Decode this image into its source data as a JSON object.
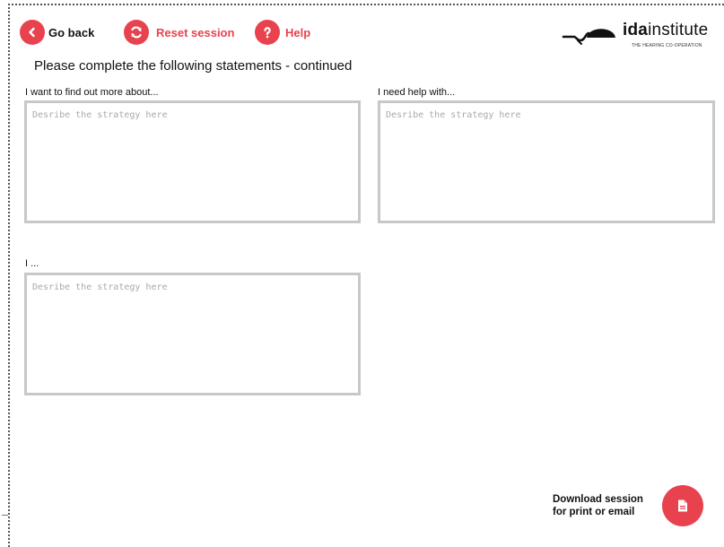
{
  "nav": {
    "back_icon": "chevron-left-icon",
    "back_label": "Go back",
    "reset_icon": "refresh-icon",
    "reset_label": "Reset session",
    "help_icon": "question-icon",
    "help_label": "Help"
  },
  "logo": {
    "brand_bold": "ida",
    "brand_rest": "institute",
    "tagline": "THE HEARING CO-OPERATION"
  },
  "page": {
    "title": "Please complete the following statements - continued"
  },
  "fields": [
    {
      "label": "I want to find out more about...",
      "placeholder": "Desribe the strategy here",
      "value": ""
    },
    {
      "label": "I need help with...",
      "placeholder": "Desribe the strategy here",
      "value": ""
    },
    {
      "label": "I ...",
      "placeholder": "Desribe the strategy here",
      "value": ""
    }
  ],
  "download": {
    "line1": "Download session",
    "line2": "for print or email",
    "icon": "document-icon"
  },
  "colors": {
    "accent": "#e8424f",
    "textbox_border": "#c8c8c8",
    "text": "#111111"
  }
}
